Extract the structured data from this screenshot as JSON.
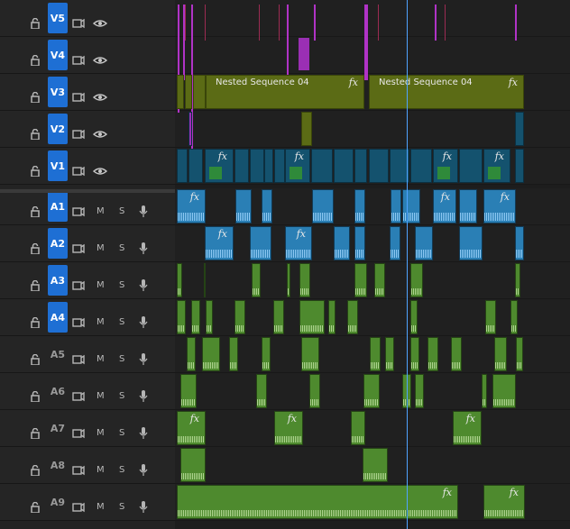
{
  "nested_clip_label": "Nested Sequence 04",
  "fx_label": "fx",
  "mute_label": "M",
  "solo_label": "S",
  "tracks": [
    {
      "id": "V5",
      "type": "video",
      "targeted": true
    },
    {
      "id": "V4",
      "type": "video",
      "targeted": true
    },
    {
      "id": "V3",
      "type": "video",
      "targeted": true
    },
    {
      "id": "V2",
      "type": "video",
      "targeted": true
    },
    {
      "id": "V1",
      "type": "video",
      "targeted": true
    },
    {
      "id": "A1",
      "type": "audio",
      "targeted": true
    },
    {
      "id": "A2",
      "type": "audio",
      "targeted": true
    },
    {
      "id": "A3",
      "type": "audio",
      "targeted": true
    },
    {
      "id": "A4",
      "type": "audio",
      "targeted": true
    },
    {
      "id": "A5",
      "type": "audio",
      "targeted": false
    },
    {
      "id": "A6",
      "type": "audio",
      "targeted": false
    },
    {
      "id": "A7",
      "type": "audio",
      "targeted": false
    },
    {
      "id": "A8",
      "type": "audio",
      "targeted": false
    },
    {
      "id": "A9",
      "type": "audio",
      "targeted": false
    }
  ],
  "icons": {
    "lock": "lock-icon",
    "sync": "sync-lock-icon",
    "eye": "eye-icon",
    "mic": "mic-icon"
  },
  "colors": {
    "target_on": "#1e6fd4",
    "video_clip": "#14526e",
    "nested_clip": "#5b6b15",
    "audio_blue": "#2a7fb5",
    "audio_green": "#4e8a2e",
    "playhead": "#4fa3ff",
    "marker": "#b033c6"
  }
}
